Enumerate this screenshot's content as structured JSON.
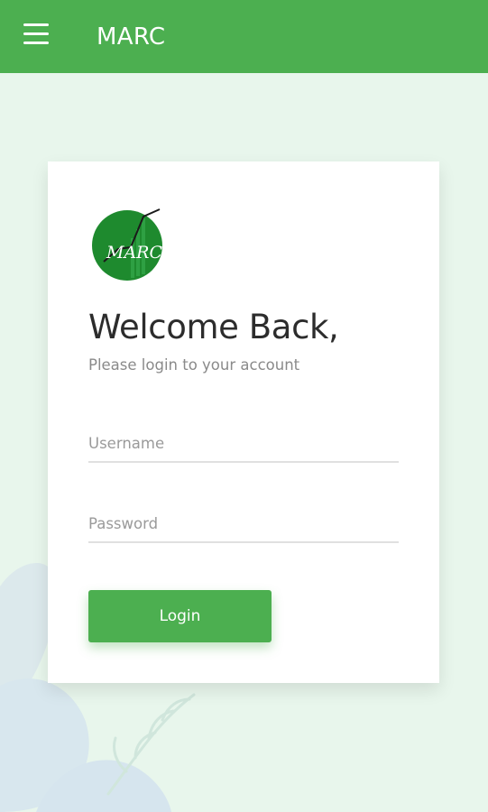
{
  "app_bar": {
    "title": "MARC",
    "menu_icon": "hamburger-menu-icon",
    "color": "#4caf50"
  },
  "login_card": {
    "logo_text": "MARC",
    "heading": "Welcome Back,",
    "subheading": "Please login to your account",
    "username_placeholder": "Username",
    "username_value": "",
    "password_placeholder": "Password",
    "password_value": "",
    "login_button_label": "Login"
  },
  "colors": {
    "accent": "#4caf50",
    "background": "#e8f6ec",
    "heading_text": "#2c2c2c",
    "muted_text": "#8a8a8a"
  }
}
